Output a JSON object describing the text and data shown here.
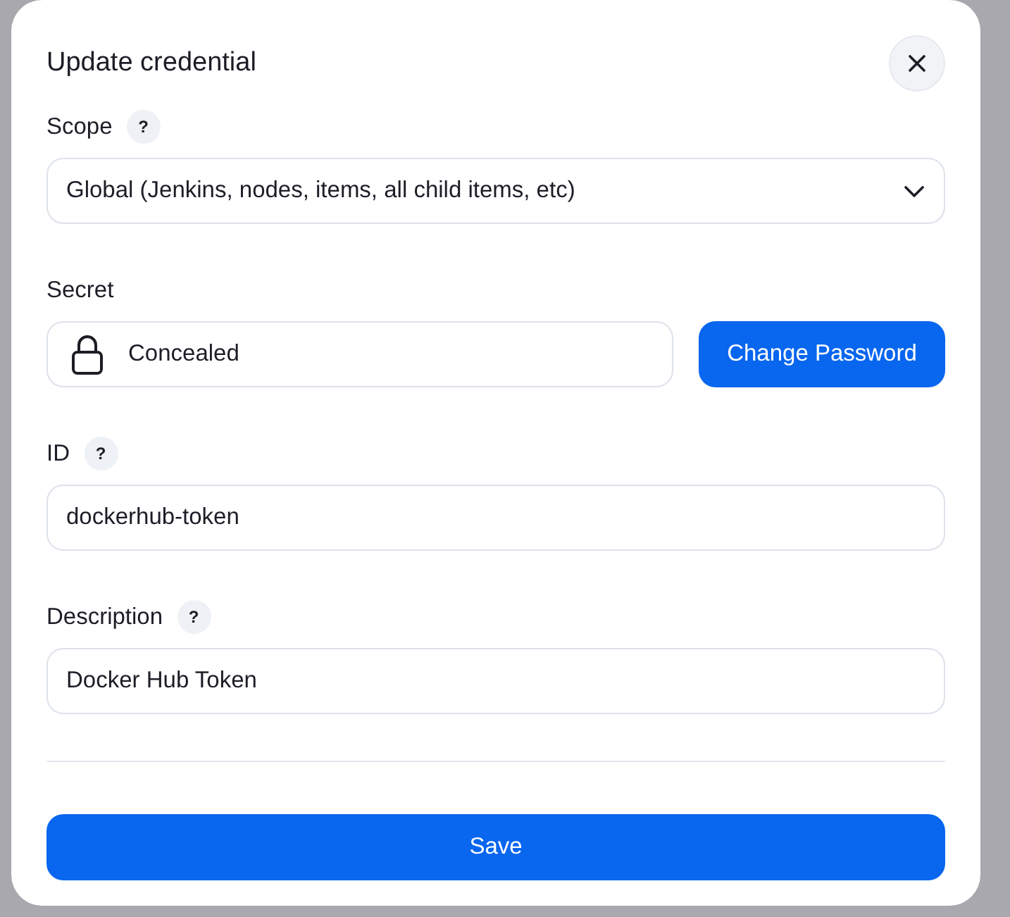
{
  "dialog": {
    "title": "Update credential"
  },
  "fields": [
    {
      "kind": "select",
      "label": "Scope",
      "help": "?",
      "value": "Global (Jenkins, nodes, items, all child items, etc)"
    },
    {
      "kind": "secret",
      "label": "Secret",
      "value": "Concealed",
      "button": "Change Password"
    },
    {
      "kind": "text",
      "label": "ID",
      "help": "?",
      "value": "dockerhub-token"
    },
    {
      "kind": "text",
      "label": "Description",
      "help": "?",
      "value": "Docker Hub Token"
    }
  ],
  "buttons": [
    {
      "label": "Save"
    }
  ]
}
